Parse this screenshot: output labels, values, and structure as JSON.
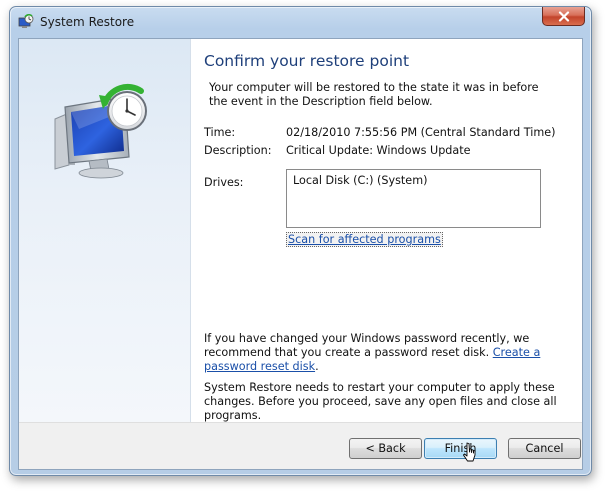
{
  "window": {
    "title": "System Restore"
  },
  "main": {
    "heading": "Confirm your restore point",
    "intro": "Your computer will be restored to the state it was in before the event in the Description field below.",
    "time_label": "Time:",
    "time_value": "02/18/2010 7:55:56 PM (Central Standard Time)",
    "description_label": "Description:",
    "description_value": "Critical Update: Windows Update",
    "drives_label": "Drives:",
    "drives": [
      "Local Disk (C:) (System)"
    ],
    "scan_link": "Scan for affected programs",
    "password_text": "If you have changed your Windows password recently, we recommend that you create a password reset disk.",
    "password_link": "Create a password reset disk",
    "restart_text": "System Restore needs to restart your computer to apply these changes. Before you proceed, save any open files and close all programs."
  },
  "footer": {
    "back_label": "< Back",
    "finish_label": "Finish",
    "cancel_label": "Cancel"
  },
  "icons": {
    "title": "system-restore-icon",
    "hero": "system-restore-monitor-icon",
    "close": "close-icon",
    "cursor": "mouse-pointer-icon"
  },
  "colors": {
    "heading": "#1e3f7a",
    "link": "#1a4fa8",
    "close_button": "#c3442b",
    "default_button": "#3c7fb1"
  }
}
